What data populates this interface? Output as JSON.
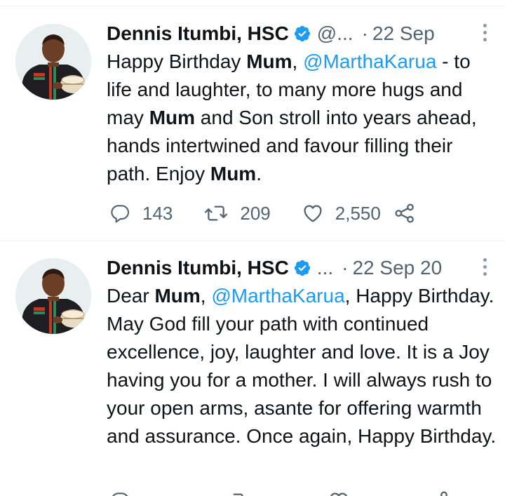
{
  "tweets": [
    {
      "author_name": "Dennis Itumbi, HSC",
      "handle": "@...",
      "separator": "·",
      "date": "22 Sep",
      "text": [
        {
          "t": "Happy Birthday "
        },
        {
          "t": "Mum",
          "bold": true
        },
        {
          "t": ", "
        },
        {
          "t": "@MarthaKarua",
          "mention": true
        },
        {
          "t": " - to life and laughter, to many more hugs and may "
        },
        {
          "t": "Mum",
          "bold": true
        },
        {
          "t": " and Son stroll into years ahead, hands intertwined and favour filling their path. Enjoy "
        },
        {
          "t": "Mum",
          "bold": true
        },
        {
          "t": "."
        }
      ],
      "replies": "143",
      "retweets": "209",
      "likes": "2,550"
    },
    {
      "author_name": "Dennis Itumbi, HSC",
      "handle": "...",
      "separator": "·",
      "date": "22 Sep 20",
      "text": [
        {
          "t": "Dear "
        },
        {
          "t": "Mum",
          "bold": true
        },
        {
          "t": ", "
        },
        {
          "t": "@MarthaKarua",
          "mention": true
        },
        {
          "t": ", Happy Birthday. May God fill your path with continued excellence, joy, laughter and love. It is a Joy having you for a mother. I will always rush to your open arms, asante for offering warmth and assurance. Once again, Happy Birthday."
        }
      ]
    }
  ],
  "icons": {
    "verified": "verified-badge-icon",
    "more": "more-options-icon",
    "reply": "reply-icon",
    "retweet": "retweet-icon",
    "like": "heart-icon",
    "share": "share-icon"
  },
  "colors": {
    "accent": "#1d9bf0",
    "text": "#0f1419",
    "muted": "#536471"
  }
}
